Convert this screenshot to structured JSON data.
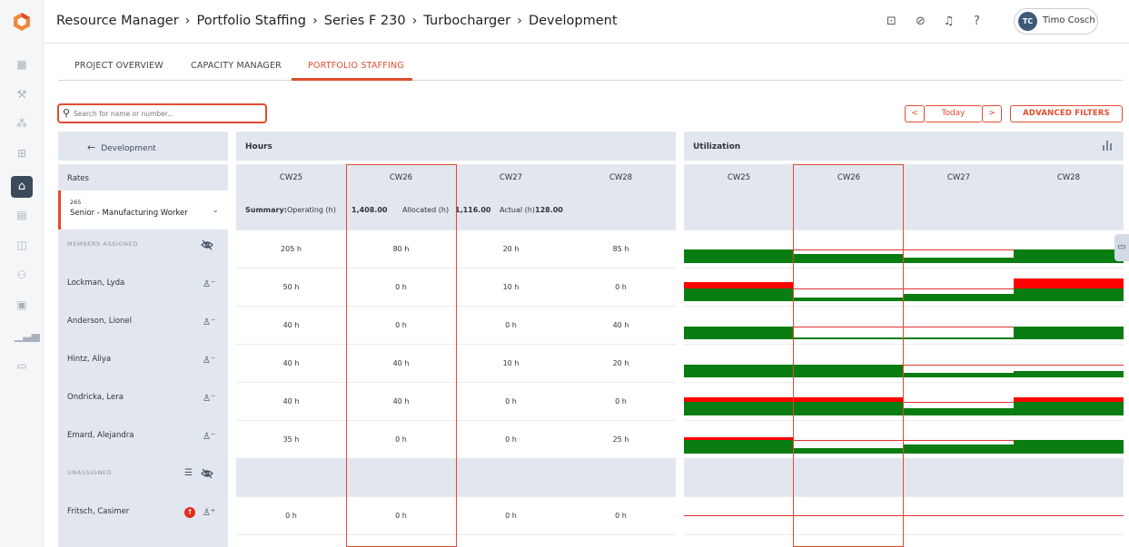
{
  "header": {
    "breadcrumb": [
      "Resource Manager",
      "Portfolio Staffing",
      "Series F 230",
      "Turbocharger",
      "Development"
    ],
    "user": {
      "initials": "TC",
      "name": "Timo Cosch"
    }
  },
  "sidebar": {
    "icons": [
      "app-logo",
      "dashboard-icon",
      "tools-icon",
      "people-icon",
      "hierarchy-icon",
      "building-icon",
      "calendar-icon",
      "money-icon",
      "nodes-icon",
      "briefcase-icon",
      "bar-chart-icon",
      "chat-icon"
    ]
  },
  "tabs": [
    "PROJECT OVERVIEW",
    "CAPACITY MANAGER",
    "PORTFOLIO STAFFING"
  ],
  "active_tab": "PORTFOLIO STAFFING",
  "search": {
    "placeholder": "Search for name or number...",
    "value": ""
  },
  "nav": {
    "prev": "<",
    "today": "Today",
    "next": ">",
    "advanced_filters": "ADVANCED FILTERS"
  },
  "left": {
    "back_label": "Development",
    "rates_label": "Rates",
    "rate": {
      "number": "265",
      "name": "Senior - Manufacturing Worker"
    },
    "members_assigned_label": "MEMBERS ASSIGNED",
    "members": [
      "Lockman, Lyda",
      "Anderson, Lionel",
      "Hintz, Aliya",
      "Ondricka, Lera",
      "Emard, Alejandra"
    ],
    "unassigned_label": "UNASSIGNED",
    "unassigned": [
      "Fritsch, Casimer"
    ]
  },
  "hours": {
    "title": "Hours",
    "weeks": [
      "CW25",
      "CW26",
      "CW27",
      "CW28"
    ],
    "summary": {
      "label": "Summary:",
      "operating_label": "Operating (h)",
      "operating": "1,408.00",
      "allocated_label": "Allocated (h)",
      "allocated": "1,116.00",
      "actual_label": "Actual (h)",
      "actual": "128.00"
    },
    "total_row": [
      "205 h",
      "80 h",
      "20 h",
      "85 h"
    ],
    "rows": [
      [
        "50 h",
        "0 h",
        "10 h",
        "0 h"
      ],
      [
        "40 h",
        "0 h",
        "0 h",
        "40 h"
      ],
      [
        "40 h",
        "40 h",
        "10 h",
        "20 h"
      ],
      [
        "40 h",
        "40 h",
        "0 h",
        "0 h"
      ],
      [
        "35 h",
        "0 h",
        "0 h",
        "25 h"
      ]
    ],
    "unassigned_rows": [
      [
        "0 h",
        "0 h",
        "0 h",
        "0 h"
      ]
    ]
  },
  "utilization": {
    "title": "Utilization",
    "weeks": [
      "CW25",
      "CW26",
      "CW27",
      "CW28"
    ]
  },
  "colors": {
    "accent": "#e24c2e",
    "util_ok": "#0a7d12",
    "util_over": "#ff0000",
    "panel": "#e2e7ef"
  }
}
